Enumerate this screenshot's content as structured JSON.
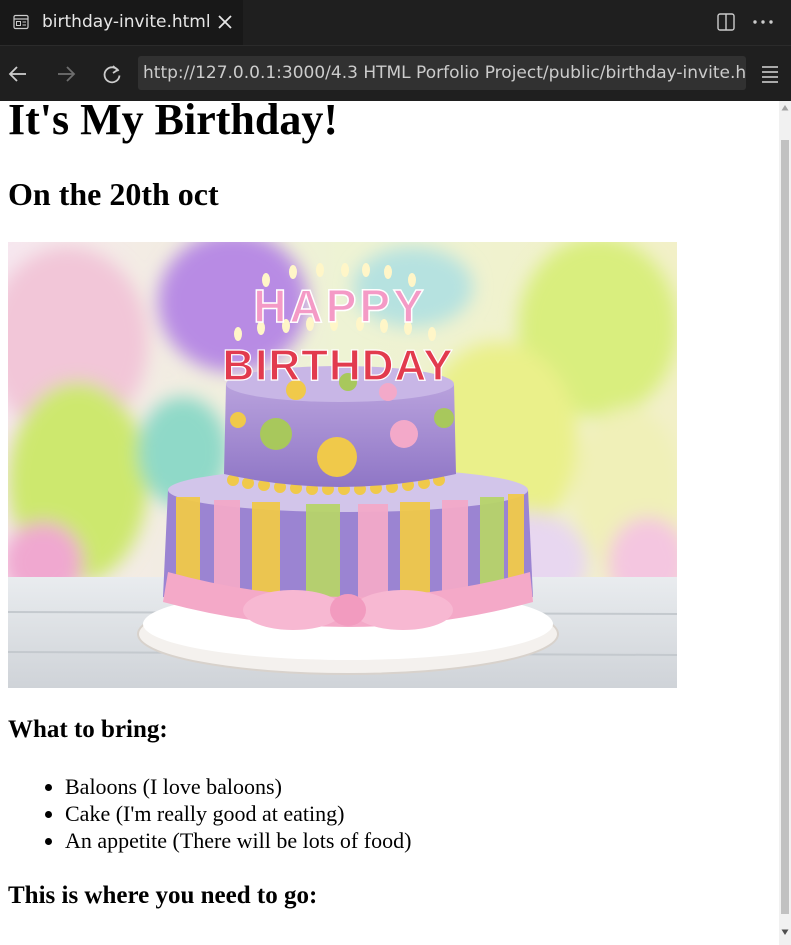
{
  "tab": {
    "title": "birthday-invite.html",
    "icon": "preview-icon",
    "close_icon": "close-icon"
  },
  "toolbar_icons": [
    "split-editor-icon",
    "more-actions-icon"
  ],
  "nav": {
    "back_icon": "arrow-left-icon",
    "forward_icon": "arrow-right-icon",
    "reload_icon": "reload-icon",
    "menu_icon": "menu-icon",
    "url": "http://127.0.0.1:3000/4.3 HTML Porfolio Project/public/birthday-invite.h"
  },
  "page": {
    "heading": "It's My Birthday!",
    "subheading": "On the 20th oct",
    "image": {
      "lettering_top": "HAPPY",
      "lettering_bottom": "BIRTHDAY"
    },
    "bring_heading": "What to bring:",
    "bring_items": [
      "Baloons (I love baloons)",
      "Cake (I'm really good at eating)",
      "An appetite (There will be lots of food)"
    ],
    "go_heading": "This is where you need to go:"
  },
  "colors": {
    "chrome_bg": "#1f1f1f",
    "tab_bg": "#181818",
    "url_bg": "#313131",
    "link": "#1a0dab"
  }
}
